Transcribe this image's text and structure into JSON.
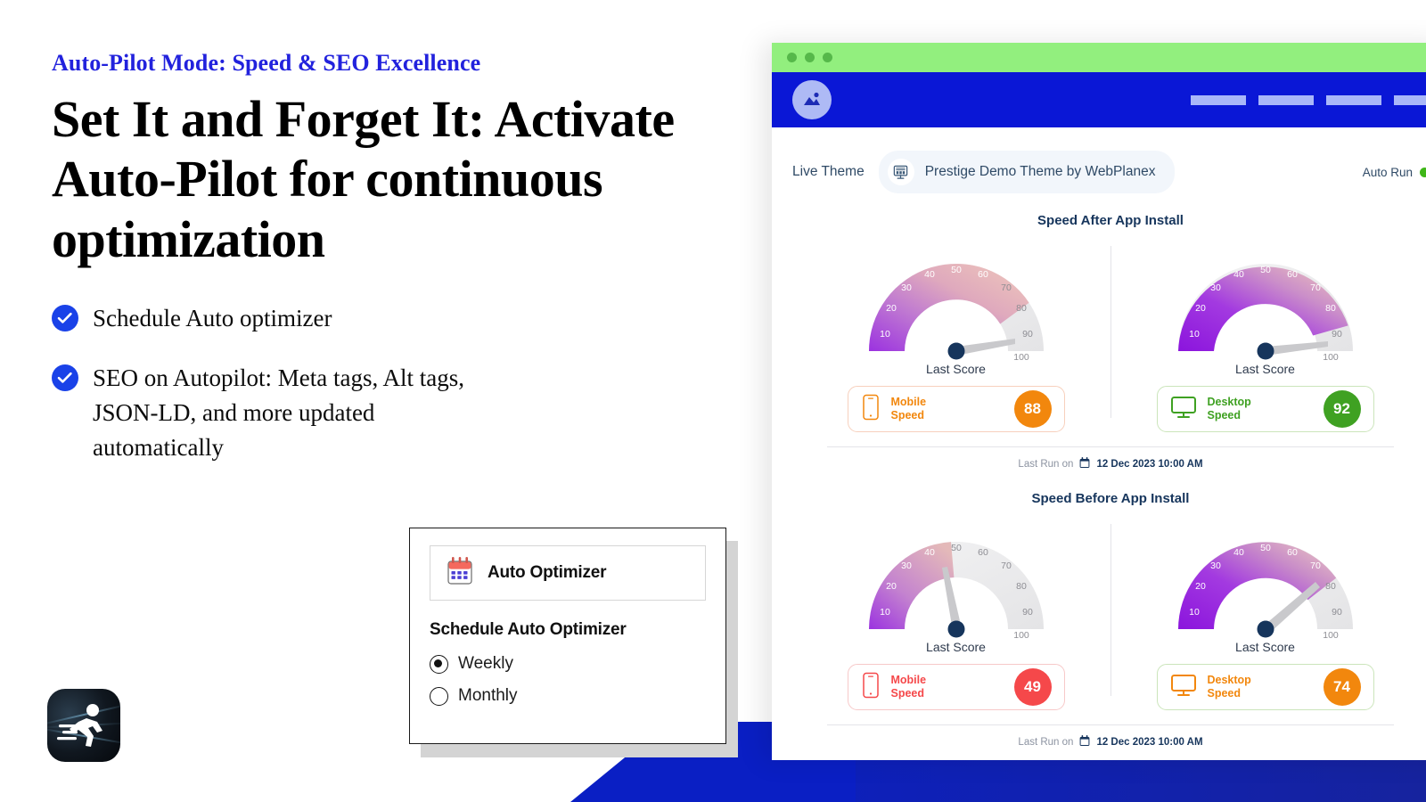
{
  "hero": {
    "eyebrow": "Auto-Pilot Mode: Speed & SEO Excellence",
    "headline": "Set It and Forget It: Activate Auto-Pilot for continuous optimization",
    "bullets": [
      {
        "text": "Schedule Auto optimizer",
        "icon": "check-circle-icon"
      },
      {
        "text": "SEO on Autopilot: Meta tags, Alt tags, JSON-LD, and more updated automatically",
        "icon": "check-circle-icon"
      }
    ],
    "accent_color": "#2222dd",
    "tick_color": "#1a42e8"
  },
  "app_badge": {
    "icon": "running-man-icon",
    "background": "#0a0f15"
  },
  "optimizer_card": {
    "header_title": "Auto Optimizer",
    "header_icon": "calendar-icon",
    "section_title": "Schedule Auto Optimizer",
    "options": [
      {
        "label": "Weekly",
        "selected": true
      },
      {
        "label": "Monthly",
        "selected": false
      }
    ]
  },
  "browser": {
    "window_dots": 3,
    "window_bar_color": "#92ef7e",
    "navbar_color": "#0a17d6",
    "nav_logo_icon": "image-placeholder-icon",
    "nav_placeholder_count": 4,
    "theme": {
      "label": "Live Theme",
      "icon": "store-monitor-icon",
      "name": "Prestige Demo Theme by WebPlanex"
    },
    "auto_run": {
      "label": "Auto Run",
      "status_color": "#3fb618"
    },
    "panels": [
      {
        "title": "Speed After App Install",
        "gauges": [
          {
            "caption": "Last Score",
            "device_label_line1": "Mobile",
            "device_label_line2": "Speed",
            "device_icon": "mobile-icon",
            "score": "88",
            "score_color": "#f2870d",
            "border_color": "#f7d0bd",
            "ticks": [
              "10",
              "20",
              "30",
              "40",
              "50",
              "60",
              "70",
              "80",
              "90",
              "100"
            ]
          },
          {
            "caption": "Last Score",
            "device_label_line1": "Desktop",
            "device_label_line2": "Speed",
            "device_icon": "desktop-icon",
            "score": "92",
            "score_color": "#3fa122",
            "border_color": "#cbe5bb",
            "ticks": [
              "10",
              "20",
              "30",
              "40",
              "50",
              "60",
              "70",
              "80",
              "90",
              "100"
            ]
          }
        ],
        "last_run_prefix": "Last Run on",
        "last_run_date": "12 Dec 2023 10:00 AM",
        "last_run_icon": "calendar-icon"
      },
      {
        "title": "Speed Before App Install",
        "gauges": [
          {
            "caption": "Last Score",
            "device_label_line1": "Mobile",
            "device_label_line2": "Speed",
            "device_icon": "mobile-icon",
            "score": "49",
            "score_color": "#f5484a",
            "border_color": "#f7c9c9",
            "ticks": [
              "10",
              "20",
              "30",
              "40",
              "50",
              "60",
              "70",
              "80",
              "90",
              "100"
            ]
          },
          {
            "caption": "Last Score",
            "device_label_line1": "Desktop",
            "device_label_line2": "Speed",
            "device_icon": "desktop-icon",
            "score": "74",
            "score_color": "#f2870d",
            "border_color": "#cbe5bb",
            "ticks": [
              "10",
              "20",
              "30",
              "40",
              "50",
              "60",
              "70",
              "80",
              "90",
              "100"
            ]
          }
        ],
        "last_run_prefix": "Last Run on",
        "last_run_date": "12 Dec 2023 10:00 AM",
        "last_run_icon": "calendar-icon"
      }
    ]
  },
  "chart_data": [
    {
      "type": "gauge",
      "title": "Speed After App Install",
      "subtitle": "Mobile Speed",
      "value": 88,
      "axis_ticks": [
        10,
        20,
        30,
        40,
        50,
        60,
        70,
        80,
        90,
        100
      ],
      "range": [
        0,
        100
      ],
      "needle_value": 88,
      "label": "Last Score",
      "value_color": "#f2870d"
    },
    {
      "type": "gauge",
      "title": "Speed After App Install",
      "subtitle": "Desktop Speed",
      "value": 92,
      "axis_ticks": [
        10,
        20,
        30,
        40,
        50,
        60,
        70,
        80,
        90,
        100
      ],
      "range": [
        0,
        100
      ],
      "needle_value": 92,
      "label": "Last Score",
      "value_color": "#3fa122"
    },
    {
      "type": "gauge",
      "title": "Speed Before App Install",
      "subtitle": "Mobile Speed",
      "value": 49,
      "axis_ticks": [
        10,
        20,
        30,
        40,
        50,
        60,
        70,
        80,
        90,
        100
      ],
      "range": [
        0,
        100
      ],
      "needle_value": 49,
      "label": "Last Score",
      "value_color": "#f5484a"
    },
    {
      "type": "gauge",
      "title": "Speed Before App Install",
      "subtitle": "Desktop Speed",
      "value": 74,
      "axis_ticks": [
        10,
        20,
        30,
        40,
        50,
        60,
        70,
        80,
        90,
        100
      ],
      "range": [
        0,
        100
      ],
      "needle_value": 74,
      "label": "Last Score",
      "value_color": "#f2870d"
    }
  ]
}
